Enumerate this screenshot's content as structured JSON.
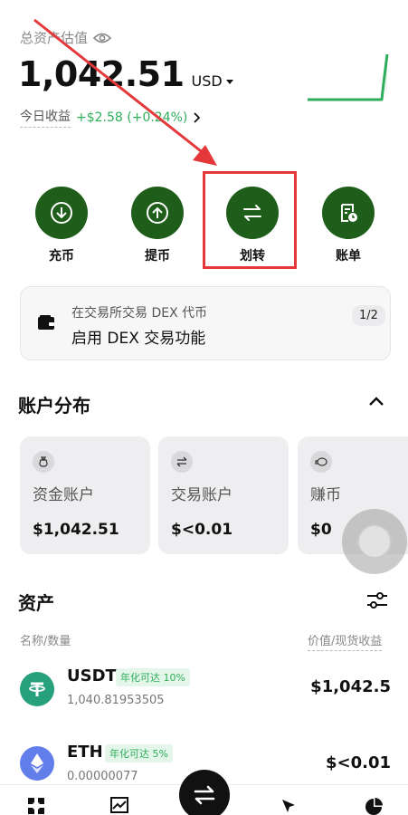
{
  "header": {
    "total_label": "总资产估值",
    "balance": "1,042.51",
    "currency": "USD",
    "pnl_label": "今日收益",
    "pnl_value": "+$2.58 (+0.24%)"
  },
  "actions": [
    {
      "label": "充币",
      "icon": "deposit-icon"
    },
    {
      "label": "提币",
      "icon": "withdraw-icon"
    },
    {
      "label": "划转",
      "icon": "transfer-icon"
    },
    {
      "label": "账单",
      "icon": "bill-icon"
    }
  ],
  "dex_banner": {
    "line1": "在交易所交易 DEX 代币",
    "line2": "启用 DEX 交易功能",
    "pager": "1/2"
  },
  "accounts": {
    "title": "账户分布",
    "items": [
      {
        "name": "资金账户",
        "value": "$1,042.51",
        "icon": "money-bag-icon"
      },
      {
        "name": "交易账户",
        "value": "$<0.01",
        "icon": "swap-icon"
      },
      {
        "name": "赚币",
        "value": "$0",
        "icon": "piggy-icon"
      }
    ]
  },
  "assets": {
    "title": "资产",
    "col_left": "名称/数量",
    "col_right": "价值/现货收益",
    "rows": [
      {
        "symbol": "USDT",
        "apy": "年化可达 10%",
        "amount": "1,040.81953505",
        "value": "$1,042.5",
        "coin_color": "#26a17b",
        "coin_glyph": "₮"
      },
      {
        "symbol": "ETH",
        "apy": "年化可达 5%",
        "amount": "0.00000077",
        "value": "$<0.01",
        "coin_color": "#627eea",
        "coin_glyph": "◆"
      }
    ]
  },
  "colors": {
    "accent_green": "#1f5d1a",
    "positive": "#2eae5b",
    "annotation_red": "#e4383a"
  }
}
